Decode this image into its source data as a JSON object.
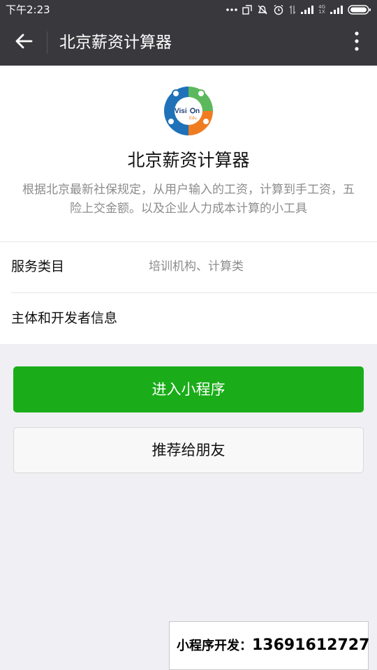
{
  "status_bar": {
    "time": "下午2:23",
    "network_label_top": "4G",
    "network_label_bottom": "1X"
  },
  "header": {
    "title": "北京薪资计算器",
    "back_icon": "arrow-left-icon",
    "more_icon": "more-vertical-icon"
  },
  "app": {
    "logo_text_main": "Visi",
    "logo_text_tail": "n",
    "logo_text_sub": "Edu",
    "name": "北京薪资计算器",
    "description": "根据北京最新社保规定，从用户输入的工资，计算到手工资，五险上交金额。以及企业人力成本计算的小工具"
  },
  "details": {
    "service_category_label": "服务类目",
    "service_category_value": "培训机构、计算类",
    "developer_info_label": "主体和开发者信息"
  },
  "actions": {
    "enter_label": "进入小程序",
    "recommend_label": "推荐给朋友"
  },
  "promo": {
    "prefix": "小程序开发：",
    "phone": "13691612727"
  },
  "colors": {
    "header_bg": "#39393d",
    "primary_green": "#1aad19",
    "page_bg": "#efeff4",
    "logo_blue": "#1f72b8",
    "logo_green": "#5cb85c",
    "logo_orange": "#f07c22"
  }
}
